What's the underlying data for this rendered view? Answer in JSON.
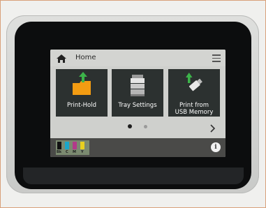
{
  "header": {
    "title": "Home"
  },
  "tiles": [
    {
      "label": "Print-Hold",
      "icon": "folder-upload-icon"
    },
    {
      "label": "Tray Settings",
      "icon": "printer-trays-icon"
    },
    {
      "label_line1": "Print from",
      "label_line2": "USB Memory",
      "icon": "usb-upload-icon"
    }
  ],
  "pager": {
    "current_page": 1,
    "total_pages": 2
  },
  "ink": [
    {
      "label": "Bk",
      "color": "#111111"
    },
    {
      "label": "C",
      "color": "#1aa7c9"
    },
    {
      "label": "M",
      "color": "#b23a8a"
    },
    {
      "label": "Y",
      "color": "#e8d020"
    }
  ],
  "colors": {
    "accent": "#f39c12",
    "tile_bg": "#2c3130",
    "upload_green": "#3cb44a"
  }
}
